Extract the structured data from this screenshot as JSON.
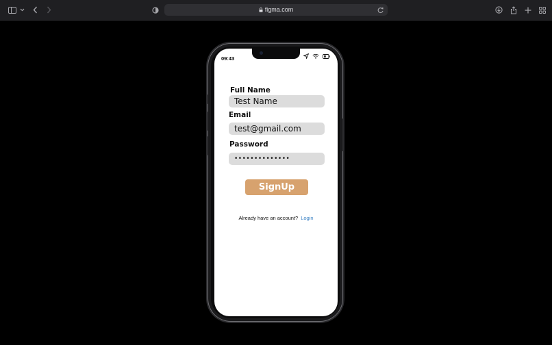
{
  "browser": {
    "url": "figma.com",
    "icons": [
      "sidebar-icon",
      "chevron-down-icon",
      "back-icon",
      "forward-icon",
      "shield-icon",
      "lock-icon",
      "reload-icon",
      "download-icon",
      "share-icon",
      "plus-icon",
      "tabs-grid-icon"
    ]
  },
  "status_bar": {
    "time": "09:43"
  },
  "form": {
    "full_name_label": "Full Name",
    "full_name_value": "Test Name",
    "email_label": "Email",
    "email_value": "test@gmail.com",
    "password_label": "Password",
    "password_value": "••••••••••••••",
    "signup_label": "SignUp"
  },
  "footer": {
    "prompt": "Already have an account?",
    "login_label": "Login"
  },
  "colors": {
    "signup_button": "#d7a26e",
    "link": "#3b82c4",
    "field_bg": "#dcdcdc"
  }
}
